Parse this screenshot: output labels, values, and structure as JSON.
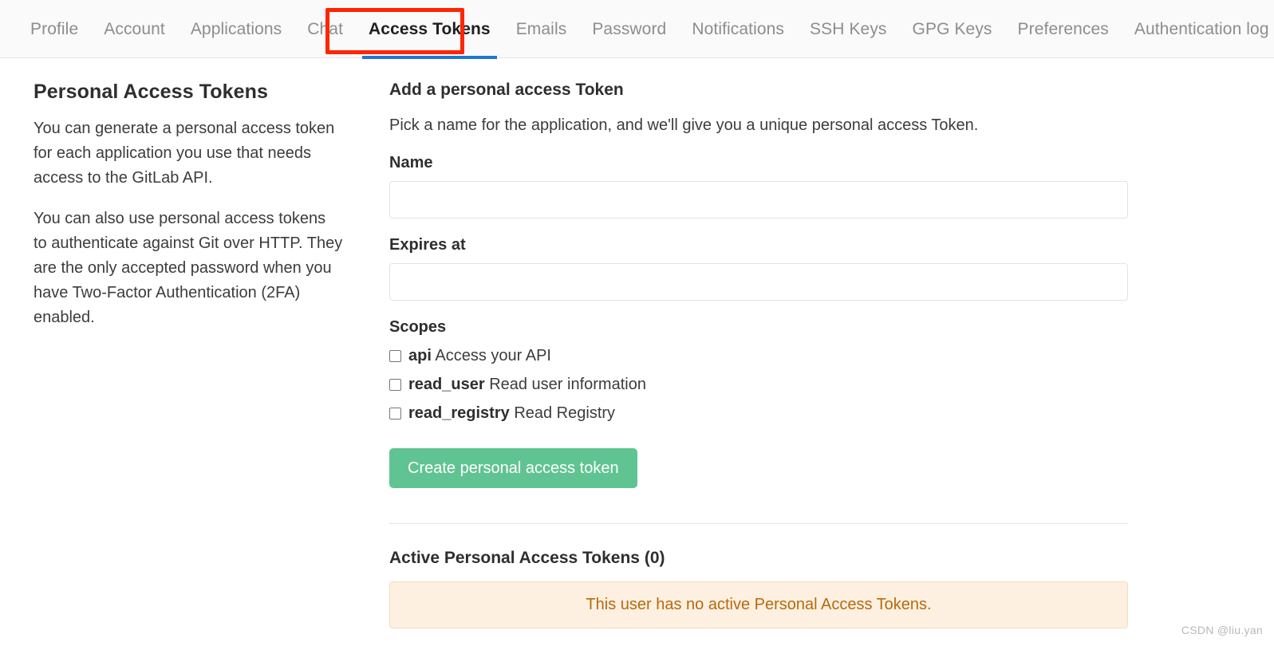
{
  "nav": {
    "tabs": [
      {
        "label": "Profile",
        "active": false
      },
      {
        "label": "Account",
        "active": false
      },
      {
        "label": "Applications",
        "active": false
      },
      {
        "label": "Chat",
        "active": false
      },
      {
        "label": "Access Tokens",
        "active": true
      },
      {
        "label": "Emails",
        "active": false
      },
      {
        "label": "Password",
        "active": false
      },
      {
        "label": "Notifications",
        "active": false
      },
      {
        "label": "SSH Keys",
        "active": false
      },
      {
        "label": "GPG Keys",
        "active": false
      },
      {
        "label": "Preferences",
        "active": false
      },
      {
        "label": "Authentication log",
        "active": false
      }
    ],
    "active_tab": "Access Tokens",
    "active_underline_color": "#1f78d1",
    "annotation_color": "#ff2500"
  },
  "sidebar": {
    "title": "Personal Access Tokens",
    "paragraph1": "You can generate a personal access token for each application you use that needs access to the GitLab API.",
    "paragraph2": "You can also use personal access tokens to authenticate against Git over HTTP. They are the only accepted password when you have Two-Factor Authentication (2FA) enabled."
  },
  "form": {
    "title": "Add a personal access Token",
    "description": "Pick a name for the application, and we'll give you a unique personal access Token.",
    "name_label": "Name",
    "name_value": "",
    "name_placeholder": "",
    "expires_label": "Expires at",
    "expires_value": "",
    "expires_placeholder": "",
    "scopes_label": "Scopes",
    "scopes": [
      {
        "key": "api",
        "description": "Access your API",
        "checked": false
      },
      {
        "key": "read_user",
        "description": "Read user information",
        "checked": false
      },
      {
        "key": "read_registry",
        "description": "Read Registry",
        "checked": false
      }
    ],
    "submit_label": "Create personal access token",
    "submit_color": "#60c492"
  },
  "active_tokens": {
    "heading": "Active Personal Access Tokens (0)",
    "count": 0,
    "empty_message": "This user has no active Personal Access Tokens.",
    "alert_bg": "#fdf0e1",
    "alert_border": "#f7dcb9",
    "alert_text_color": "#b8690c"
  },
  "watermark": {
    "text": "CSDN @liu.yan"
  }
}
